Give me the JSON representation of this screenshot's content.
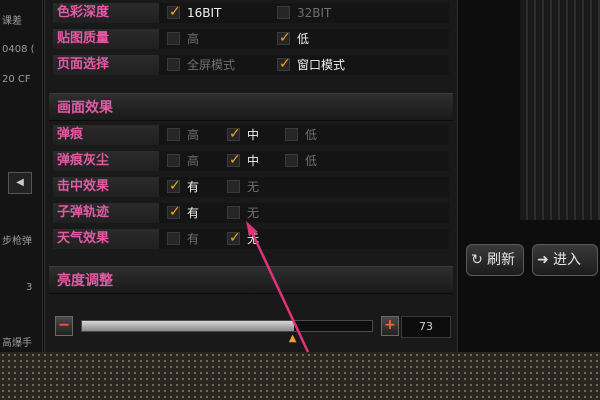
{
  "left_panel": {
    "texts": [
      "课差",
      "0408 (",
      "20 CF",
      "步枪弹",
      "3",
      "高爆手"
    ]
  },
  "settings": {
    "rows_top": [
      {
        "label": "色彩深度",
        "options": [
          {
            "text": "16BIT",
            "checked": true
          },
          {
            "text": "32BIT",
            "checked": false
          }
        ]
      },
      {
        "label": "贴图质量",
        "options": [
          {
            "text": "高",
            "checked": false
          },
          {
            "text": "低",
            "checked": true
          }
        ]
      },
      {
        "label": "页面选择",
        "options": [
          {
            "text": "全屏模式",
            "checked": false
          },
          {
            "text": "窗口模式",
            "checked": true
          }
        ]
      }
    ],
    "section_effects": "画面效果",
    "rows_effects": [
      {
        "label": "弹痕",
        "options": [
          {
            "text": "高",
            "checked": false
          },
          {
            "text": "中",
            "checked": true
          },
          {
            "text": "低",
            "checked": false
          }
        ]
      },
      {
        "label": "弹痕灰尘",
        "options": [
          {
            "text": "高",
            "checked": false
          },
          {
            "text": "中",
            "checked": true
          },
          {
            "text": "低",
            "checked": false
          }
        ]
      },
      {
        "label": "击中效果",
        "options": [
          {
            "text": "有",
            "checked": true
          },
          {
            "text": "无",
            "checked": false
          }
        ]
      },
      {
        "label": "子弹轨迹",
        "options": [
          {
            "text": "有",
            "checked": true
          },
          {
            "text": "无",
            "checked": false
          }
        ]
      },
      {
        "label": "天气效果",
        "options": [
          {
            "text": "有",
            "checked": false
          },
          {
            "text": "无",
            "checked": true
          }
        ]
      }
    ],
    "section_brightness": "亮度调整",
    "brightness": {
      "minus": "−",
      "plus": "+",
      "value": "73",
      "fill_fraction": 0.73
    }
  },
  "right_panel": {
    "refresh_label": "刷新",
    "enter_label": "进入"
  },
  "colors": {
    "accent_label": "#e45aa5",
    "check": "#f3a31e",
    "arrow": "#e0337a"
  }
}
